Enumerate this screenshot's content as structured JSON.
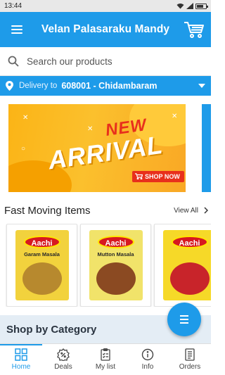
{
  "status_bar": {
    "time": "13:44"
  },
  "header": {
    "title": "Velan Palasaraku Mandy",
    "menu_icon": "hamburger-menu-icon",
    "cart_icon": "shopping-cart-icon"
  },
  "search": {
    "placeholder": "Search our products",
    "value": ""
  },
  "delivery": {
    "prefix": "Delivery to",
    "location": "608001 - Chidambaram"
  },
  "banner": {
    "line1": "NEW",
    "line2": "ARRIVAL",
    "button": "SHOP NOW"
  },
  "fast_moving": {
    "title": "Fast Moving Items",
    "view_all": "View All",
    "products": [
      {
        "brand": "Aachi",
        "name": "Garam Masala"
      },
      {
        "brand": "Aachi",
        "name": "Mutton Masala"
      },
      {
        "brand": "Aachi",
        "name": ""
      }
    ]
  },
  "shop_by_category": {
    "title": "Shop by Category"
  },
  "bottom_nav": [
    {
      "label": "Home",
      "icon": "grid-icon",
      "active": true
    },
    {
      "label": "Deals",
      "icon": "deals-badge-icon",
      "active": false
    },
    {
      "label": "My list",
      "icon": "checklist-icon",
      "active": false
    },
    {
      "label": "Info",
      "icon": "info-icon",
      "active": false
    },
    {
      "label": "Orders",
      "icon": "orders-icon",
      "active": false
    }
  ],
  "colors": {
    "primary": "#1e9be9",
    "banner_yellow": "#fbc02d",
    "banner_red": "#e8301c",
    "aachi_red": "#d71920"
  }
}
